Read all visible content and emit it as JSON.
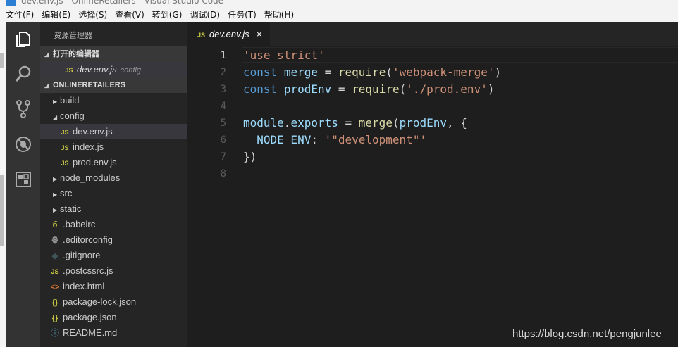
{
  "window": {
    "title": "dev.env.js - OnlineRetailers - Visual Studio Code"
  },
  "menu": [
    "文件(F)",
    "编辑(E)",
    "选择(S)",
    "查看(V)",
    "转到(G)",
    "调试(D)",
    "任务(T)",
    "帮助(H)"
  ],
  "activity_bar": [
    "files-icon",
    "search-icon",
    "source-control-icon",
    "debug-icon",
    "extensions-icon"
  ],
  "sidebar": {
    "title": "资源管理器",
    "open_editors": {
      "label": "打开的编辑器",
      "items": [
        {
          "icon": "JS",
          "name": "dev.env.js",
          "desc": "config"
        }
      ]
    },
    "project": {
      "label": "ONLINERETAILERS",
      "items": [
        {
          "name": "build",
          "icon": "folder-closed"
        },
        {
          "name": "config",
          "icon": "folder-open"
        },
        {
          "name": "dev.env.js",
          "icon": "JS"
        },
        {
          "name": "index.js",
          "icon": "JS"
        },
        {
          "name": "prod.env.js",
          "icon": "JS"
        },
        {
          "name": "node_modules",
          "icon": "folder-closed"
        },
        {
          "name": "src",
          "icon": "folder-closed"
        },
        {
          "name": "static",
          "icon": "folder-closed"
        },
        {
          "name": ".babelrc",
          "icon": "6"
        },
        {
          "name": ".editorconfig",
          "icon": "⚙"
        },
        {
          "name": ".gitignore",
          "icon": "◆"
        },
        {
          "name": ".postcssrc.js",
          "icon": "JS"
        },
        {
          "name": "index.html",
          "icon": "<>"
        },
        {
          "name": "package-lock.json",
          "icon": "{}"
        },
        {
          "name": "package.json",
          "icon": "{}"
        },
        {
          "name": "README.md",
          "icon": "ⓘ"
        }
      ]
    }
  },
  "editor": {
    "tab": {
      "icon": "JS",
      "name": "dev.env.js",
      "close": "×"
    },
    "line_numbers": [
      "1",
      "2",
      "3",
      "4",
      "5",
      "6",
      "7",
      "8"
    ],
    "code": {
      "l1": "'use strict'",
      "l2_kw": "const",
      "l2_var": "merge",
      "l2_eq": " = ",
      "l2_fn": "require",
      "l2_open": "(",
      "l2_str": "'webpack-merge'",
      "l2_close": ")",
      "l3_kw": "const",
      "l3_var": "prodEnv",
      "l3_eq": " = ",
      "l3_fn": "require",
      "l3_open": "(",
      "l3_str": "'./prod.env'",
      "l3_close": ")",
      "l5_mod": "module",
      "l5_dot": ".",
      "l5_exp": "exports",
      "l5_eq": " = ",
      "l5_fn": "merge",
      "l5_open": "(",
      "l5_arg": "prodEnv",
      "l5_rest": ", {",
      "l6_key": "NODE_ENV",
      "l6_colon": ": ",
      "l6_str": "'\"development\"'",
      "l7": "})"
    }
  },
  "watermark": "https://blog.csdn.net/pengjunlee"
}
